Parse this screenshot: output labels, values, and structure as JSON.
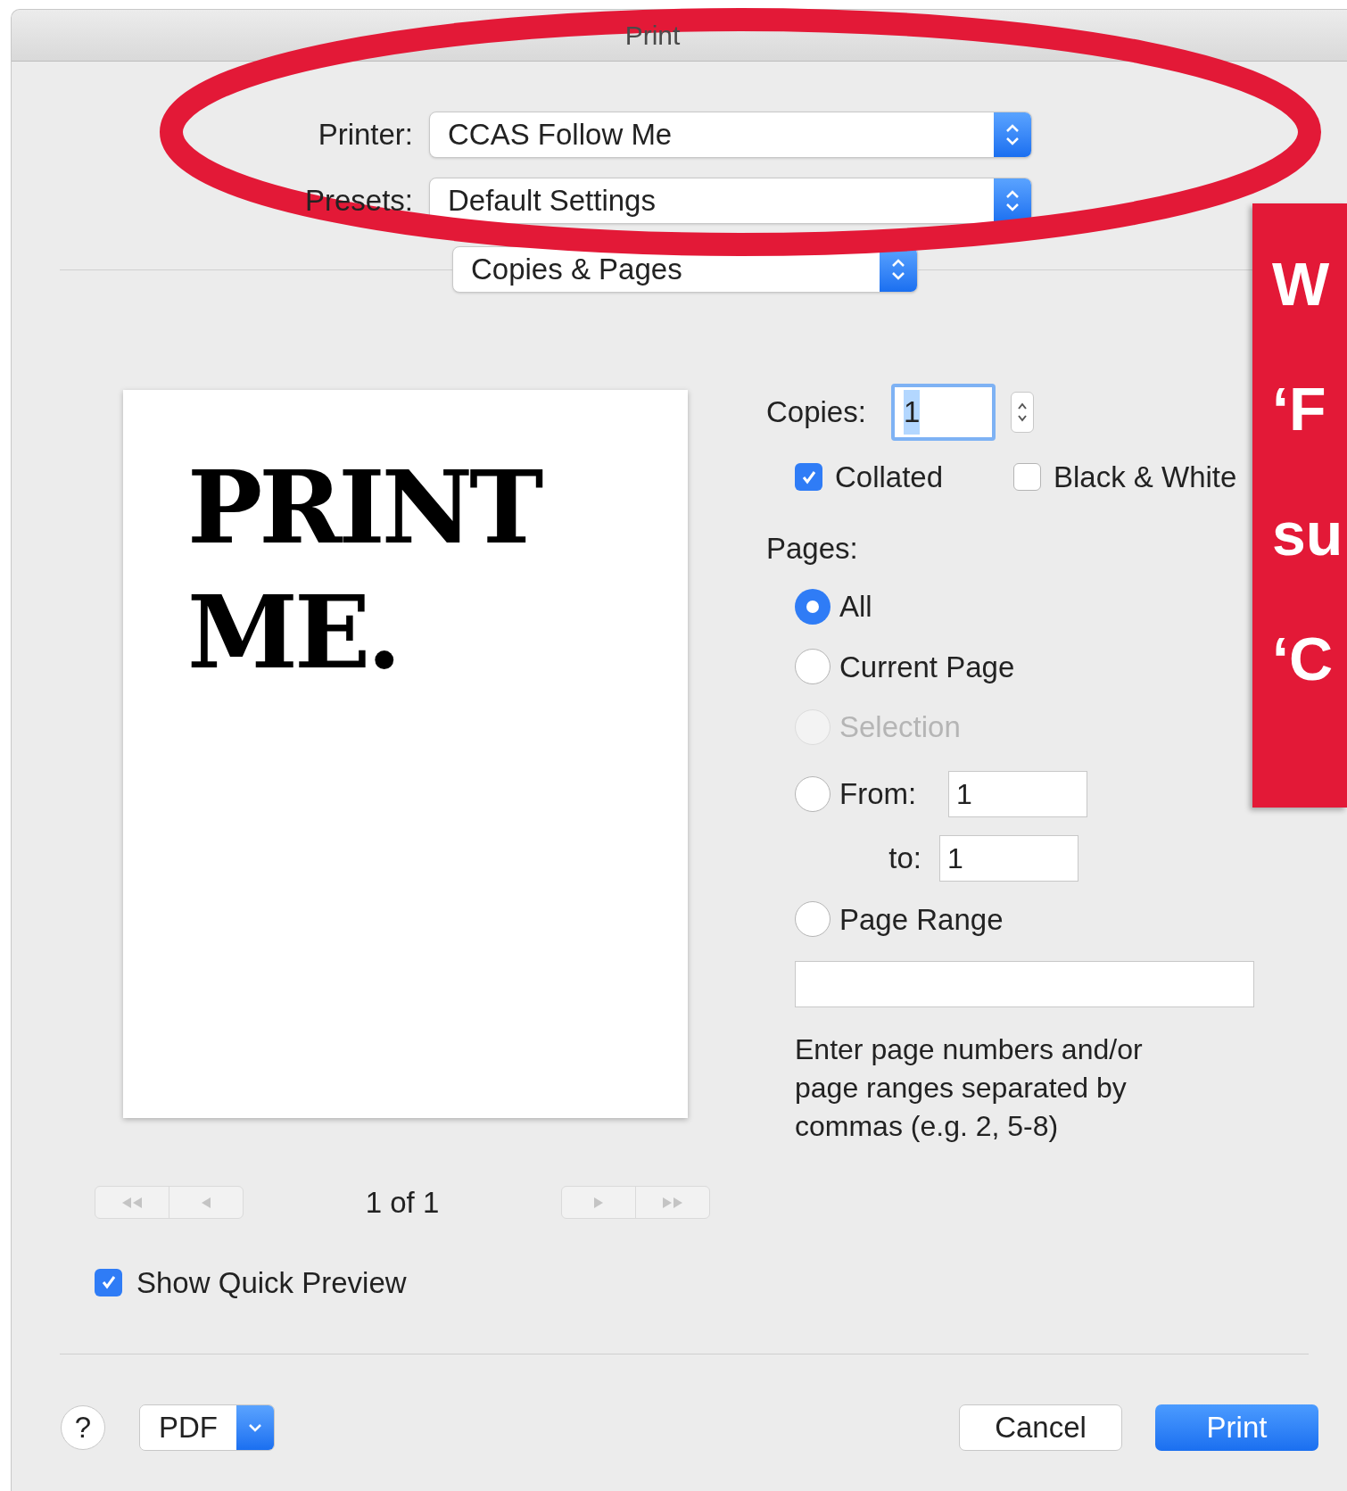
{
  "window": {
    "title": "Print"
  },
  "printer": {
    "label": "Printer:",
    "value": "CCAS Follow Me"
  },
  "presets": {
    "label": "Presets:",
    "value": "Default Settings"
  },
  "section": {
    "value": "Copies & Pages"
  },
  "preview": {
    "lines": [
      "PRINT",
      "ME."
    ],
    "page_info": "1 of 1"
  },
  "copies": {
    "label": "Copies:",
    "value": "1"
  },
  "options": [
    {
      "label": "Collated",
      "checked": true
    },
    {
      "label": "Black & White",
      "checked": false
    }
  ],
  "pages": {
    "label": "Pages:",
    "choices": [
      {
        "kind": "plain",
        "label": "All",
        "selected": true,
        "disabled": false
      },
      {
        "kind": "plain",
        "label": "Current Page",
        "selected": false,
        "disabled": false
      },
      {
        "kind": "plain",
        "label": "Selection",
        "selected": false,
        "disabled": true
      },
      {
        "kind": "from",
        "label": "From:",
        "selected": false,
        "disabled": false,
        "from_value": "1",
        "to_label": "to:",
        "to_value": "1"
      },
      {
        "kind": "range",
        "label": "Page Range",
        "selected": false,
        "disabled": false,
        "hint": "Enter page numbers and/or page ranges separated by commas (e.g. 2, 5-8)"
      }
    ]
  },
  "show_quick_preview": {
    "label": "Show Quick Preview",
    "checked": true
  },
  "footer": {
    "help": "?",
    "pdf": "PDF",
    "cancel": "Cancel",
    "print": "Print"
  },
  "callout": {
    "lines": [
      "W",
      "‘F",
      "su",
      "‘C"
    ]
  }
}
